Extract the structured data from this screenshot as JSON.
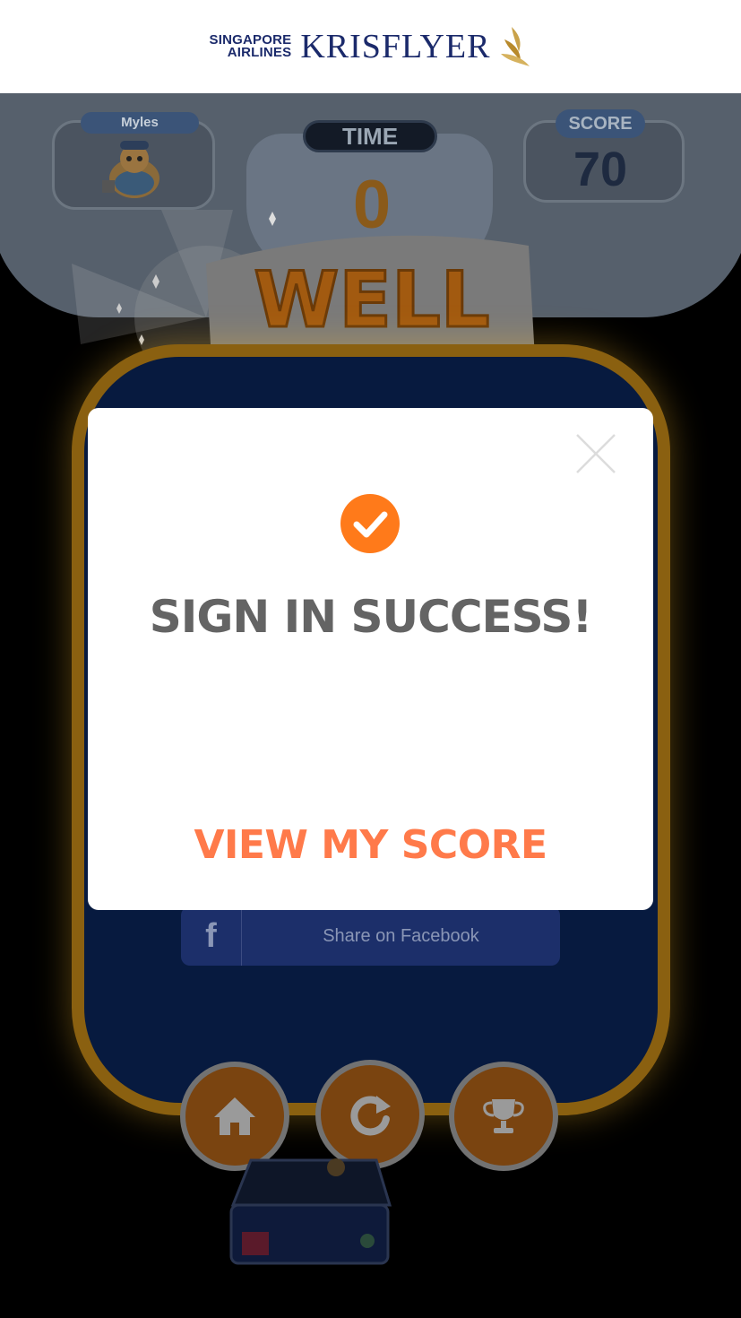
{
  "header": {
    "airline_line1": "SINGAPORE",
    "airline_line2": "AIRLINES",
    "program": "KRISFLYER",
    "brand_color": "#1b2a6b",
    "logo_icon": "bird-logo-icon"
  },
  "game": {
    "player_name": "Myles",
    "time_label": "TIME",
    "time_value": "0",
    "score_label": "SCORE",
    "score_value": "70",
    "banner_text": "WELL DONE",
    "share_facebook_label": "Share on Facebook",
    "buttons": [
      {
        "name": "home",
        "icon": "home-icon"
      },
      {
        "name": "replay",
        "icon": "replay-icon"
      },
      {
        "name": "leaderboard",
        "icon": "trophy-icon"
      }
    ]
  },
  "modal": {
    "title": "SIGN IN SUCCESS!",
    "action_label": "VIEW MY SCORE",
    "success_icon": "check-circle-icon",
    "close_icon": "close-icon",
    "accent_color": "#ff7a2a",
    "title_color": "#646464"
  }
}
